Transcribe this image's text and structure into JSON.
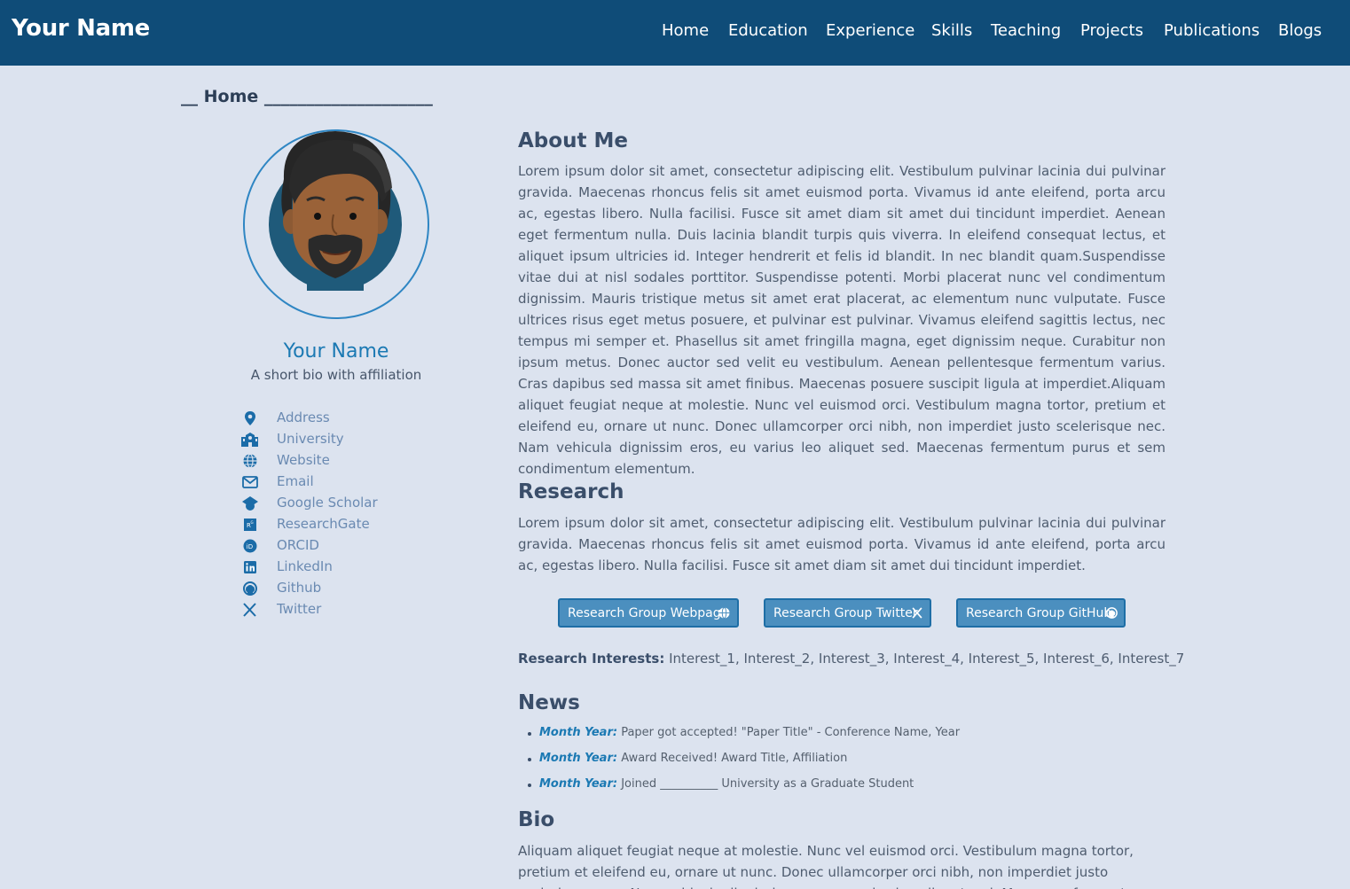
{
  "navbar": {
    "brand": "Your Name",
    "items": [
      {
        "label": "Home"
      },
      {
        "label": "Education"
      },
      {
        "label": "Experience"
      },
      {
        "label": "Skills"
      },
      {
        "label": "Teaching"
      },
      {
        "label": "Projects"
      },
      {
        "label": "Publications"
      },
      {
        "label": "Blogs"
      }
    ]
  },
  "page": {
    "breadcrumb": "__ Home ____________________"
  },
  "profile": {
    "name": "Your Name",
    "bio": "A short bio with affiliation",
    "links": [
      {
        "label": "Address",
        "icon": "map-marker-icon"
      },
      {
        "label": "University",
        "icon": "university-icon"
      },
      {
        "label": "Website",
        "icon": "globe-icon"
      },
      {
        "label": "Email",
        "icon": "envelope-icon"
      },
      {
        "label": "Google Scholar",
        "icon": "google-scholar-icon"
      },
      {
        "label": "ResearchGate",
        "icon": "researchgate-icon"
      },
      {
        "label": "ORCID",
        "icon": "orcid-icon"
      },
      {
        "label": "LinkedIn",
        "icon": "linkedin-icon"
      },
      {
        "label": "Github",
        "icon": "github-icon"
      },
      {
        "label": "Twitter",
        "icon": "x-twitter-icon"
      }
    ]
  },
  "about": {
    "heading": "About Me",
    "text": "Lorem ipsum dolor sit amet, consectetur adipiscing elit. Vestibulum pulvinar lacinia dui pulvinar gravida. Maecenas rhoncus felis sit amet euismod porta. Vivamus id ante eleifend, porta arcu ac, egestas libero. Nulla facilisi. Fusce sit amet diam sit amet dui tincidunt imperdiet. Aenean eget fermentum nulla. Duis lacinia blandit turpis quis viverra. In eleifend consequat lectus, et aliquet ipsum ultricies id. Integer hendrerit et felis id blandit. In nec blandit quam.Suspendisse vitae dui at nisl sodales porttitor. Suspendisse potenti. Morbi placerat nunc vel condimentum dignissim. Mauris tristique metus sit amet erat placerat, ac elementum nunc vulputate. Fusce ultrices risus eget metus posuere, et pulvinar est pulvinar. Vivamus eleifend sagittis lectus, nec tempus mi semper et. Phasellus sit amet fringilla magna, eget dignissim neque. Curabitur non ipsum metus. Donec auctor sed velit eu vestibulum. Aenean pellentesque fermentum varius. Cras dapibus sed massa sit amet finibus. Maecenas posuere suscipit ligula at imperdiet.Aliquam aliquet feugiat neque at molestie. Nunc vel euismod orci. Vestibulum magna tortor, pretium et eleifend eu, ornare ut nunc. Donec ullamcorper orci nibh, non imperdiet justo scelerisque nec. Nam vehicula dignissim eros, eu varius leo aliquet sed. Maecenas fermentum purus et sem condimentum elementum."
  },
  "research": {
    "heading": "Research",
    "text": "Lorem ipsum dolor sit amet, consectetur adipiscing elit. Vestibulum pulvinar lacinia dui pulvinar gravida. Maecenas rhoncus felis sit amet euismod porta. Vivamus id ante eleifend, porta arcu ac, egestas libero. Nulla facilisi. Fusce sit amet diam sit amet dui tincidunt imperdiet.",
    "buttons": [
      {
        "label": "Research Group Webpage",
        "icon": "globe-icon"
      },
      {
        "label": "Research Group Twitter",
        "icon": "x-twitter-icon"
      },
      {
        "label": "Research Group GitHub",
        "icon": "github-icon"
      }
    ],
    "interests_label": "Research Interests:",
    "interests": "Interest_1, Interest_2, Interest_3, Interest_4, Interest_5, Interest_6, Interest_7"
  },
  "news": {
    "heading": "News",
    "items": [
      {
        "date": "Month Year:",
        "text": "Paper got accepted! \"Paper Title\" - Conference Name, Year"
      },
      {
        "date": "Month Year:",
        "text": "Award Received! Award Title, Affiliation"
      },
      {
        "date": "Month Year:",
        "text": "Joined __________ University as a Graduate Student"
      }
    ]
  },
  "bio": {
    "heading": "Bio",
    "text": "Aliquam aliquet feugiat neque at molestie. Nunc vel euismod orci. Vestibulum magna tortor, pretium et eleifend eu, ornare ut nunc. Donec ullamcorper orci nibh, non imperdiet justo scelerisque nec. Nam vehicula dignissim eros, eu varius leo aliquet sed. Maecenas fermentum purus et sem condimentum elementum."
  },
  "colors": {
    "navbar": "#0f4c78",
    "background": "#dce3ef",
    "accent": "#1b79b3",
    "button": "#4b8fbf"
  }
}
